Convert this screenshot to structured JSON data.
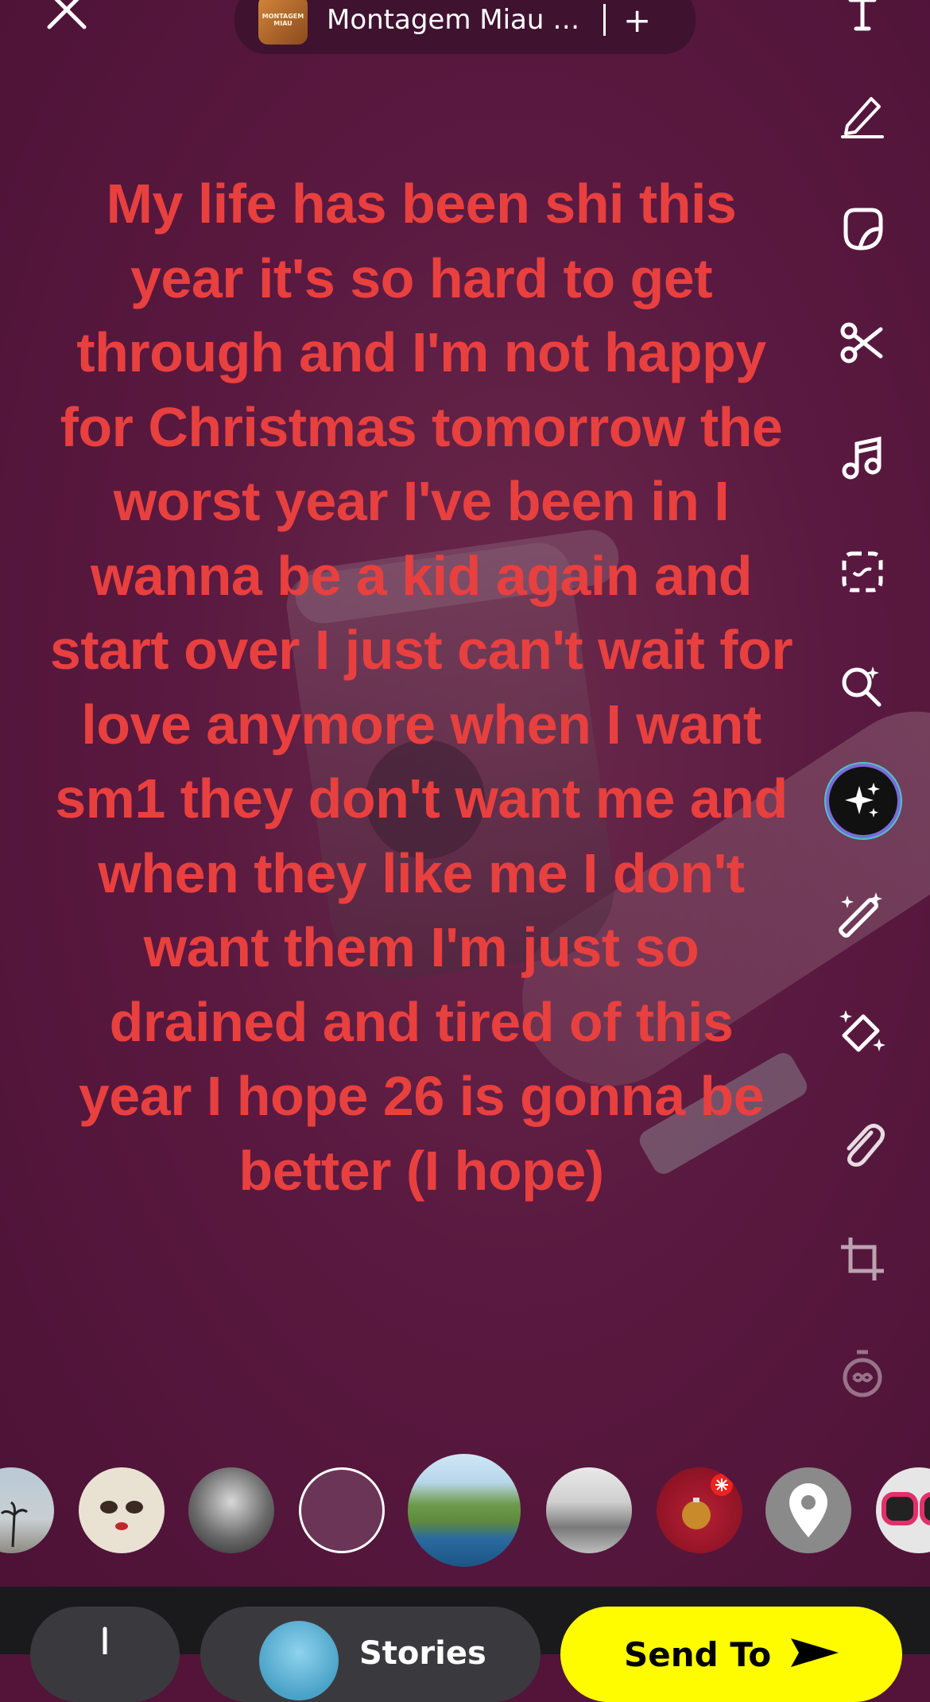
{
  "header": {
    "sound_title": "Montagem Miau - L...",
    "sound_art_text": "MONTAGEM MIAU",
    "add_label": "+"
  },
  "caption": "My life has been shi this year it's so hard to get through and I'm not happy for Christmas tomorrow the worst year I've been in I wanna be a kid again and start over I just can't wait for love anymore when I want sm1 they don't want me and when they like me I don't want them I'm just so drained and tired of this year I hope 26 is gonna be better (I hope)",
  "toolbar": [
    "text-icon",
    "pencil-icon",
    "sticker-icon",
    "scissors-icon",
    "music-note-icon",
    "scan-icon",
    "search-sparkle-icon",
    "ai-sparkle-icon",
    "magic-wand-icon",
    "eraser-icon",
    "paperclip-icon",
    "crop-icon",
    "timer-infinity-icon"
  ],
  "lenses": [
    "beach-palms-lens",
    "cute-face-lens",
    "portrait-lens",
    "empty-color-lens",
    "mountain-lake-lens",
    "mountain-bw-lens",
    "christmas-ornament-lens",
    "location-pin-lens",
    "goggles-lens"
  ],
  "bottom_bar": {
    "stories_label": "Stories",
    "send_label": "Send To"
  },
  "colors": {
    "caption": "#e8403f",
    "background": "#541339",
    "send_button": "#fffc00"
  }
}
